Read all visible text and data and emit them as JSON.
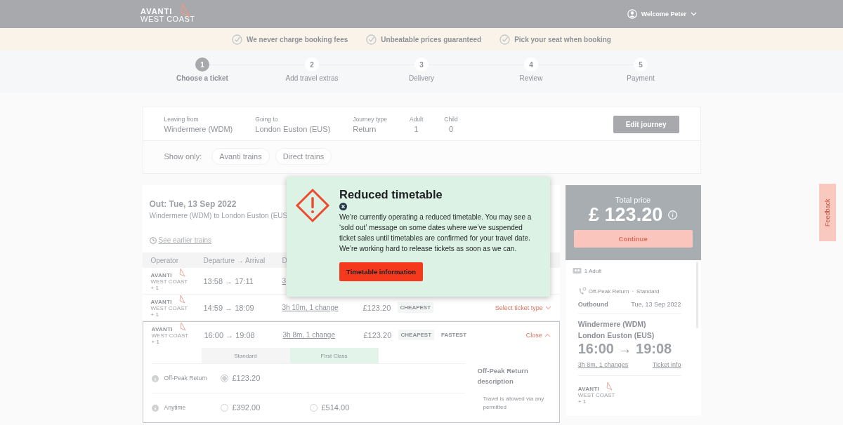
{
  "header": {
    "logo": {
      "line1": "AVANTI",
      "line2": "WEST COAST"
    },
    "user": "Welcome Peter"
  },
  "promises": [
    "We never charge booking fees",
    "Unbeatable prices guaranteed",
    "Pick your seat when booking"
  ],
  "steps": [
    {
      "number": "1",
      "label": "Choose a ticket",
      "selected": true
    },
    {
      "number": "2",
      "label": "Add travel extras",
      "selected": false
    },
    {
      "number": "3",
      "label": "Delivery",
      "selected": false
    },
    {
      "number": "4",
      "label": "Review",
      "selected": false
    },
    {
      "number": "5",
      "label": "Payment",
      "selected": false
    }
  ],
  "journey": {
    "fields": [
      {
        "label": "Leaving from",
        "value": "Windermere (WDM)",
        "kind": "wide"
      },
      {
        "label": "Going to",
        "value": "London Euston (EUS)",
        "kind": "wide"
      },
      {
        "label": "Journey type",
        "value": "Return",
        "kind": "wide"
      },
      {
        "label": "Adult",
        "value": "1",
        "kind": "count"
      },
      {
        "label": "Child",
        "value": "0",
        "kind": "count"
      }
    ],
    "edit_button": "Edit journey",
    "filter_label": "Show only:",
    "filters": [
      {
        "label": "Avanti trains",
        "selected": false
      },
      {
        "label": "Direct trains",
        "selected": false
      }
    ]
  },
  "results": {
    "title": "Out: Tue, 13 Sep 2022",
    "route": "Windermere (WDM) to London Euston (EUS",
    "earlier_link": "See earlier trains",
    "columns": [
      "Operator",
      "Departure → Arrival",
      "D"
    ],
    "rows": [
      {
        "operator": {
          "line1": "AVANTI",
          "line2": "WEST COAST",
          "extra": "+ 1"
        },
        "times": "13:58 → 17:11",
        "duration": "3",
        "expanded": false
      },
      {
        "operator": {
          "line1": "AVANTI",
          "line2": "WEST COAST",
          "extra": "+ 1"
        },
        "times": "14:59 → 18:09",
        "duration": "3h 10m, 1 change",
        "price": "£123.20",
        "tags": [
          "CHEAPEST"
        ],
        "action": "Select ticket type",
        "expanded": false
      },
      {
        "operator": {
          "line1": "AVANTI",
          "line2": "WEST COAST",
          "extra": "+ 1"
        },
        "times": "16:00 → 19:08",
        "duration": "3h 8m, 1 change",
        "price": "£123.20",
        "tags": [
          "CHEAPEST",
          "FASTEST"
        ],
        "action": "Close",
        "expanded": true
      }
    ],
    "fare_classes": [
      {
        "label": "Standard",
        "selected": false
      },
      {
        "label": "First Class",
        "selected": true
      }
    ],
    "fares": [
      {
        "name": "Off-Peak Return",
        "standard": {
          "price": "£123.20",
          "selected": true
        }
      },
      {
        "name": "Anytime",
        "standard": {
          "price": "£392.00",
          "selected": false
        },
        "first_class": {
          "price": "£514.00",
          "selected": false
        }
      }
    ],
    "description": {
      "title": "Off-Peak Return description",
      "bullets": [
        "Travel is allowed via any permitted"
      ]
    }
  },
  "summary": {
    "total_label": "Total price",
    "total": "£ 123.20",
    "continue_button": "Continue",
    "passengers": "1 Adult",
    "ticket": {
      "fare": "Off-Peak Return",
      "separator": "·",
      "class": "Standard",
      "direction": "Outbound",
      "date": "Tue, 13 Sep 2022",
      "from": "Windermere (WDM)",
      "to": "London Euston (EUS)",
      "times": "16:00 → 19:08",
      "duration": "3h 8m, 1 changes",
      "info_link": "Ticket info",
      "operator": {
        "line1": "AVANTI",
        "line2": "WEST COAST",
        "extra": "+ 1"
      }
    }
  },
  "feedback": "Feedback",
  "modal": {
    "title": "Reduced timetable",
    "body": "We’re currently operating a reduced timetable. You may see a ‘sold out’ message on some dates where we’ve suspended ticket sales until timetables are confirmed for your travel date. We’re working hard to release tickets as soon as we can.",
    "button": "Timetable information"
  }
}
